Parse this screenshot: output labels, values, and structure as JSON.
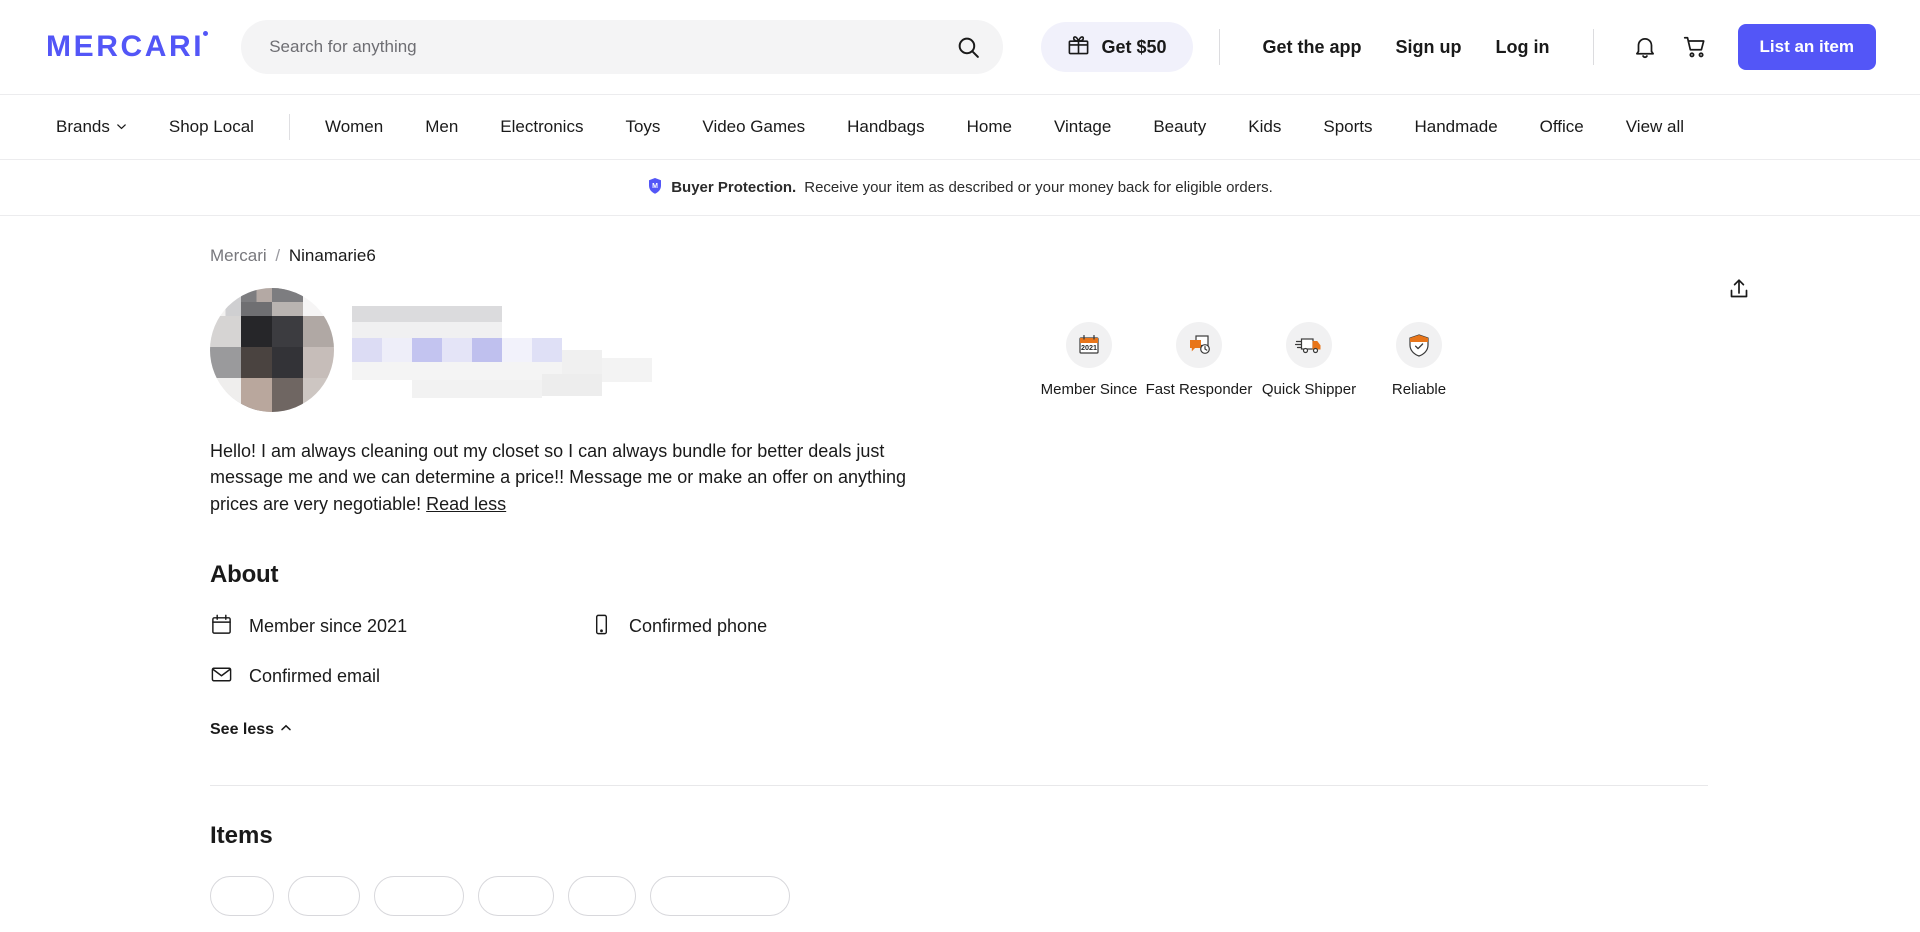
{
  "brand": {
    "logo_text": "MERCARI",
    "accent_color": "#5356f7",
    "badge_accent_color": "#e8751a"
  },
  "header": {
    "search": {
      "placeholder": "Search for anything",
      "value": "",
      "icon": "search-icon"
    },
    "get_50_label": "Get $50",
    "get_50_icon": "gift-icon",
    "links": [
      {
        "label": "Get the app"
      },
      {
        "label": "Sign up"
      },
      {
        "label": "Log in"
      }
    ],
    "notifications_icon": "bell-icon",
    "cart_icon": "cart-icon",
    "list_item_label": "List an item"
  },
  "category_nav": {
    "items": [
      {
        "label": "Brands",
        "has_chevron": true
      },
      {
        "label": "Shop Local",
        "has_chevron": false
      },
      {
        "label": "Women",
        "has_chevron": false
      },
      {
        "label": "Men",
        "has_chevron": false
      },
      {
        "label": "Electronics",
        "has_chevron": false
      },
      {
        "label": "Toys",
        "has_chevron": false
      },
      {
        "label": "Video Games",
        "has_chevron": false
      },
      {
        "label": "Handbags",
        "has_chevron": false
      },
      {
        "label": "Home",
        "has_chevron": false
      },
      {
        "label": "Vintage",
        "has_chevron": false
      },
      {
        "label": "Beauty",
        "has_chevron": false
      },
      {
        "label": "Kids",
        "has_chevron": false
      },
      {
        "label": "Sports",
        "has_chevron": false
      },
      {
        "label": "Handmade",
        "has_chevron": false
      },
      {
        "label": "Office",
        "has_chevron": false
      },
      {
        "label": "View all",
        "has_chevron": false
      }
    ]
  },
  "banner": {
    "icon": "shield-icon",
    "bold_text": "Buyer Protection.",
    "text": "Receive your item as described or your money back for eligible orders."
  },
  "breadcrumb": {
    "root": "Mercari",
    "separator": "/",
    "current": "Ninamarie6"
  },
  "share": {
    "icon": "share-icon"
  },
  "profile": {
    "avatar": "redacted-avatar",
    "username_redacted": "redacted-username",
    "bio": "Hello! I am always cleaning out my closet so I can always bundle for better deals just message me and we can determine a price!! Message me or make an offer on anything prices are very negotiable!",
    "read_less_label": "Read less"
  },
  "about": {
    "heading": "About",
    "items": [
      {
        "label": "Member since 2021",
        "icon": "calendar-icon"
      },
      {
        "label": "Confirmed phone",
        "icon": "phone-icon"
      },
      {
        "label": "Confirmed email",
        "icon": "envelope-icon"
      }
    ],
    "see_less_label": "See less",
    "see_less_icon": "chevron-up-icon"
  },
  "badges": [
    {
      "label": "Member Since",
      "icon": "calendar-2021-badge-icon",
      "year": "2021"
    },
    {
      "label": "Fast Responder",
      "icon": "chat-clock-badge-icon"
    },
    {
      "label": "Quick Shipper",
      "icon": "truck-badge-icon"
    },
    {
      "label": "Reliable",
      "icon": "shield-check-badge-icon"
    }
  ],
  "items_section": {
    "heading": "Items",
    "filter_chips": [
      "",
      "",
      "",
      "",
      "",
      ""
    ]
  }
}
